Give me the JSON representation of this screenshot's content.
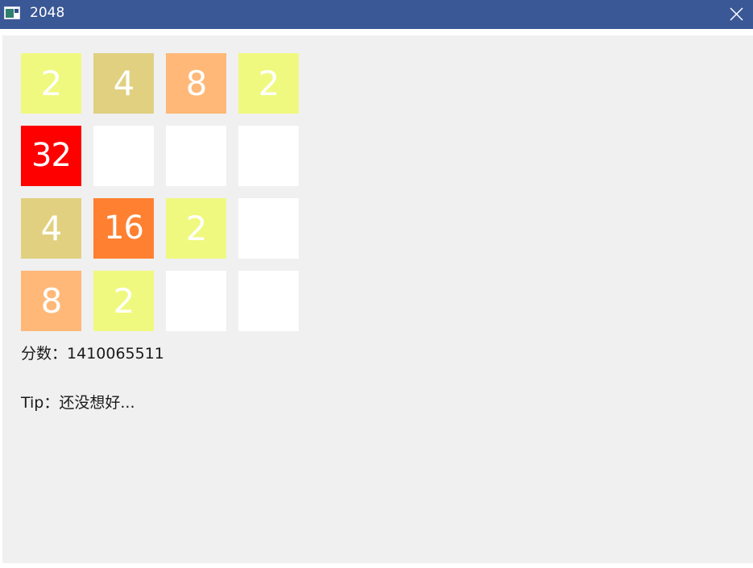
{
  "window": {
    "title": "2048",
    "titlebar_color": "#3b5896",
    "client_bg": "#f0f0f0"
  },
  "board": {
    "cells": [
      [
        "2",
        "4",
        "8",
        "2"
      ],
      [
        "32",
        "",
        "",
        ""
      ],
      [
        "4",
        "16",
        "2",
        ""
      ],
      [
        "8",
        "2",
        "",
        ""
      ]
    ],
    "tile_colors": {
      "": "#ffffff",
      "2": "#f0f97f",
      "4": "#e0d080",
      "8": "#ffb878",
      "16": "#ff8030",
      "32": "#ff0000"
    }
  },
  "score": {
    "label": "分数：",
    "value": "1410065511"
  },
  "tip": {
    "label": "Tip：",
    "text": "还没想好..."
  }
}
